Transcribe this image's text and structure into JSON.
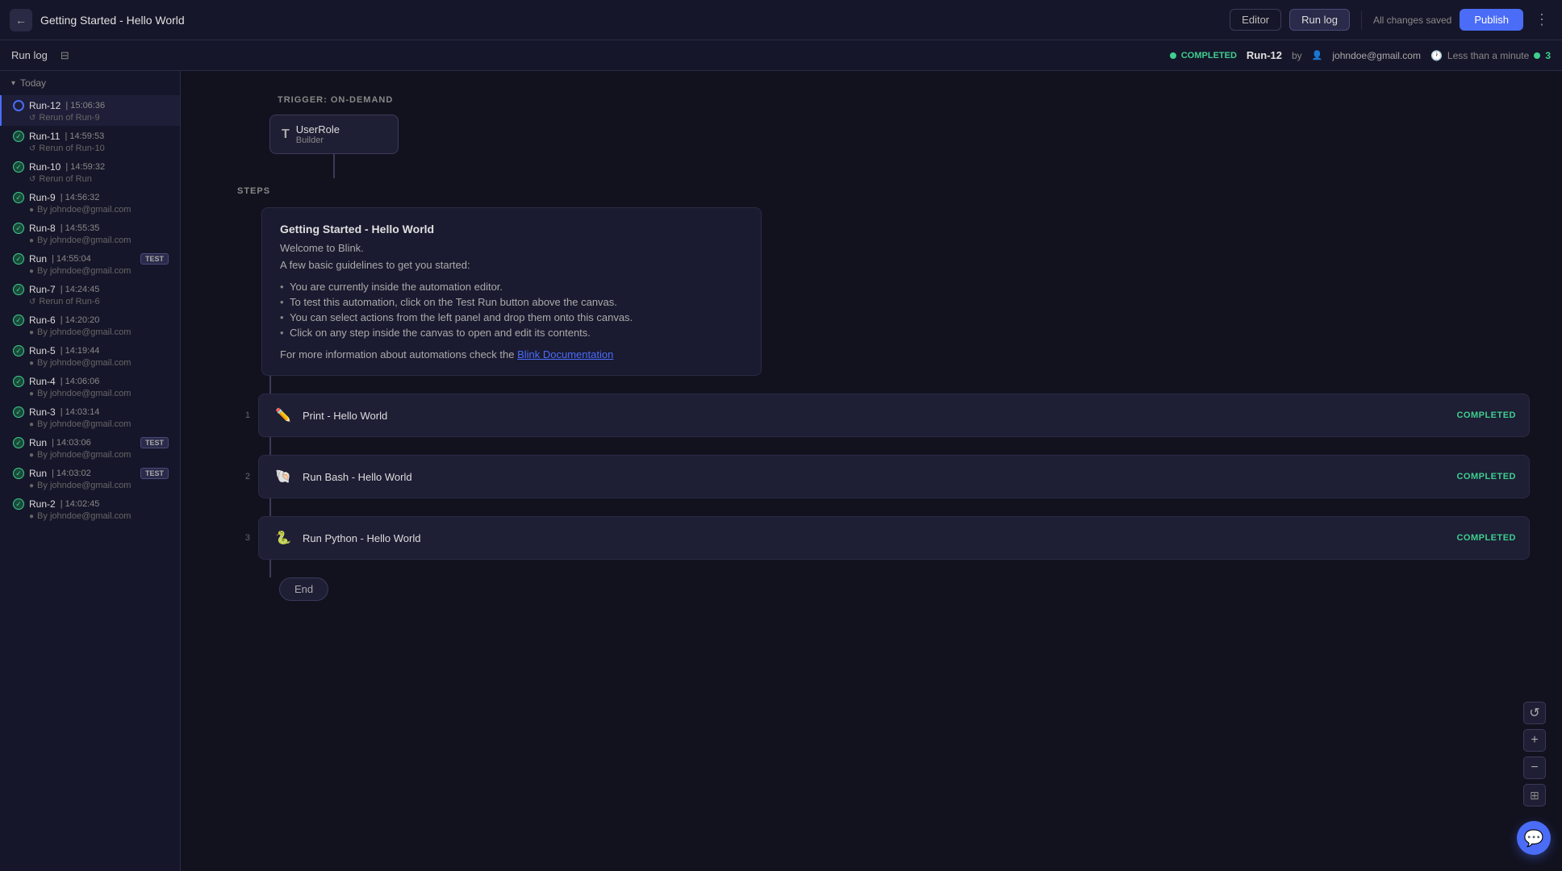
{
  "header": {
    "back_label": "←",
    "title": "Getting Started - Hello World",
    "btn_editor": "Editor",
    "btn_runlog": "Run log",
    "all_changes": "All changes saved",
    "btn_publish": "Publish",
    "menu_dots": "⋮"
  },
  "sub_header": {
    "run_log_title": "Run log",
    "completed_text": "COMPLETED",
    "run_id": "Run-12",
    "by_text": "by",
    "email": "johndoe@gmail.com",
    "time_text": "Less than a minute",
    "dot_count": "3"
  },
  "sidebar": {
    "section_label": "Today",
    "runs": [
      {
        "id": "Run-12",
        "time": "15:06:36",
        "sub": "Rerun of Run-9",
        "sub_icon": "↺",
        "status": "active",
        "test": false
      },
      {
        "id": "Run-11",
        "time": "14:59:53",
        "sub": "Rerun of Run-10",
        "sub_icon": "↺",
        "status": "done",
        "test": false
      },
      {
        "id": "Run-10",
        "time": "14:59:32",
        "sub": "Rerun of Run",
        "sub_icon": "↺",
        "status": "done",
        "test": false
      },
      {
        "id": "Run-9",
        "time": "14:56:32",
        "sub": "By johndoe@gmail.com",
        "sub_icon": "👤",
        "status": "done",
        "test": false
      },
      {
        "id": "Run-8",
        "time": "14:55:35",
        "sub": "By johndoe@gmail.com",
        "sub_icon": "👤",
        "status": "done",
        "test": false
      },
      {
        "id": "Run",
        "time": "14:55:04",
        "sub": "By johndoe@gmail.com",
        "sub_icon": "👤",
        "status": "done",
        "test": true
      },
      {
        "id": "Run-7",
        "time": "14:24:45",
        "sub": "Rerun of Run-6",
        "sub_icon": "↺",
        "status": "done",
        "test": false
      },
      {
        "id": "Run-6",
        "time": "14:20:20",
        "sub": "By johndoe@gmail.com",
        "sub_icon": "👤",
        "status": "done",
        "test": false
      },
      {
        "id": "Run-5",
        "time": "14:19:44",
        "sub": "By johndoe@gmail.com",
        "sub_icon": "👤",
        "status": "done",
        "test": false
      },
      {
        "id": "Run-4",
        "time": "14:06:06",
        "sub": "By johndoe@gmail.com",
        "sub_icon": "👤",
        "status": "done",
        "test": false
      },
      {
        "id": "Run-3",
        "time": "14:03:14",
        "sub": "By johndoe@gmail.com",
        "sub_icon": "👤",
        "status": "done",
        "test": false
      },
      {
        "id": "Run",
        "time": "14:03:06",
        "sub": "By johndoe@gmail.com",
        "sub_icon": "👤",
        "status": "done",
        "test": true
      },
      {
        "id": "Run",
        "time": "14:03:02",
        "sub": "By johndoe@gmail.com",
        "sub_icon": "👤",
        "status": "done",
        "test": true
      },
      {
        "id": "Run-2",
        "time": "14:02:45",
        "sub": "By johndoe@gmail.com",
        "sub_icon": "👤",
        "status": "done",
        "test": false
      }
    ]
  },
  "canvas": {
    "trigger_label": "TRIGGER: ON-DEMAND",
    "trigger_node": {
      "icon": "T",
      "name": "UserRole",
      "sub": "Builder"
    },
    "steps_label": "STEPS",
    "info_card": {
      "title": "Getting Started - Hello World",
      "welcome": "Welcome to Blink.",
      "guideline": "A few basic guidelines to get you started:",
      "bullets": [
        "You are currently inside the automation editor.",
        "To test this automation, click on the Test Run button above the canvas.",
        "You can select actions from the left panel and drop them onto this canvas.",
        "Click on any step inside the canvas to open and edit its contents."
      ],
      "footer": "For more information about automations check the ",
      "link_text": "Blink Documentation"
    },
    "steps": [
      {
        "number": "1",
        "icon": "✏️",
        "name": "Print - Hello World",
        "status": "COMPLETED"
      },
      {
        "number": "2",
        "icon": "🐚",
        "name": "Run Bash - Hello World",
        "status": "COMPLETED"
      },
      {
        "number": "3",
        "icon": "🐍",
        "name": "Run Python - Hello World",
        "status": "COMPLETED"
      }
    ],
    "end_label": "End"
  },
  "zoom": {
    "refresh_icon": "↺",
    "plus_icon": "+",
    "minus_icon": "−",
    "grid_icon": "⊞"
  },
  "chat_icon": "💬"
}
